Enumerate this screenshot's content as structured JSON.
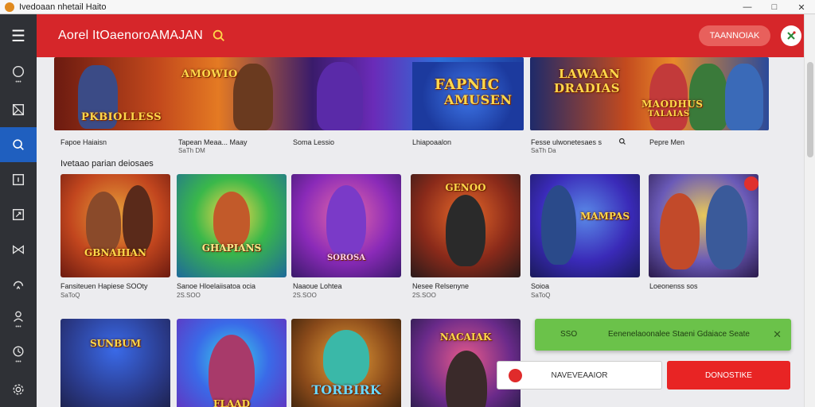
{
  "window": {
    "title": "Ivedoaan nhetail Haito"
  },
  "header": {
    "brand": "Aorel ItOaenoroAMAJAN",
    "button_label": "TAANNOIAK"
  },
  "banners": [
    {
      "art_text": "PKBIOLLESS",
      "art_text2": "AMOWIO",
      "label": "Fapoe Haiaisn",
      "price": ""
    },
    {
      "art_text": "",
      "label": "Tapean Meaa... Maay",
      "price": "SaTh DM"
    },
    {
      "art_text": "",
      "label": "Soma Lessio",
      "price": ""
    },
    {
      "art_text": "FAPNIC",
      "art_text2": "AMUSEN",
      "label": "Lhiapoaalon",
      "price": ""
    },
    {
      "art_text": "LAWAAN",
      "art_text2": "DRADIAS",
      "label": "Fesse ulwonetesaes s",
      "price": "SaTh Da"
    },
    {
      "art_text": "MAODHUS",
      "art_text2": "TALAIAS",
      "label": "Pepre Men",
      "price": ""
    }
  ],
  "section_title": "Ivetaao parian deiosaes",
  "cards": [
    {
      "art_text": "GBNAHIAN",
      "title": "Fansiteuen Hapiese SOOty",
      "price": "SaToQ",
      "has_badge": false
    },
    {
      "art_text": "GHAPIANS",
      "title": "Sanoe Hloelaiisatoa ocia",
      "price": "2S.SOO",
      "has_badge": false
    },
    {
      "art_text": "SOROSA",
      "title": "Naaoue Lohtea",
      "price": "2S.SOO",
      "has_badge": false
    },
    {
      "art_text": "GENOO",
      "title": "Nesee Relsenyne",
      "price": "2S.SOO",
      "has_badge": false
    },
    {
      "art_text": "MAMPAS",
      "title": "Soioa",
      "price": "SaToQ",
      "has_badge": false
    },
    {
      "art_text": "",
      "title": "Loeonenss sos",
      "price": "",
      "has_badge": true
    },
    {
      "art_text": "SUNBUM",
      "title": "",
      "price": "",
      "has_badge": false
    },
    {
      "art_text": "FLAAD",
      "title": "",
      "price": "",
      "has_badge": false
    },
    {
      "art_text": "TORBIRK",
      "title": "",
      "price": "",
      "has_badge": false
    },
    {
      "art_text": "NACAIAK",
      "title": "",
      "price": "",
      "has_badge": false
    }
  ],
  "toast": {
    "code": "SSO",
    "message": "Eenenelaoonalee Staeni Gdaiace Seate"
  },
  "actions": {
    "secondary_label": "NAVEVEAAIOR",
    "primary_label": "DONOSTIKE"
  },
  "colors": {
    "header_red": "#d6262a",
    "sidebar_dark": "#2f3136",
    "active_blue": "#1f5fbf",
    "toast_green": "#6bc24a",
    "primary_red": "#e82424",
    "art_gold": "#ffd84a"
  }
}
